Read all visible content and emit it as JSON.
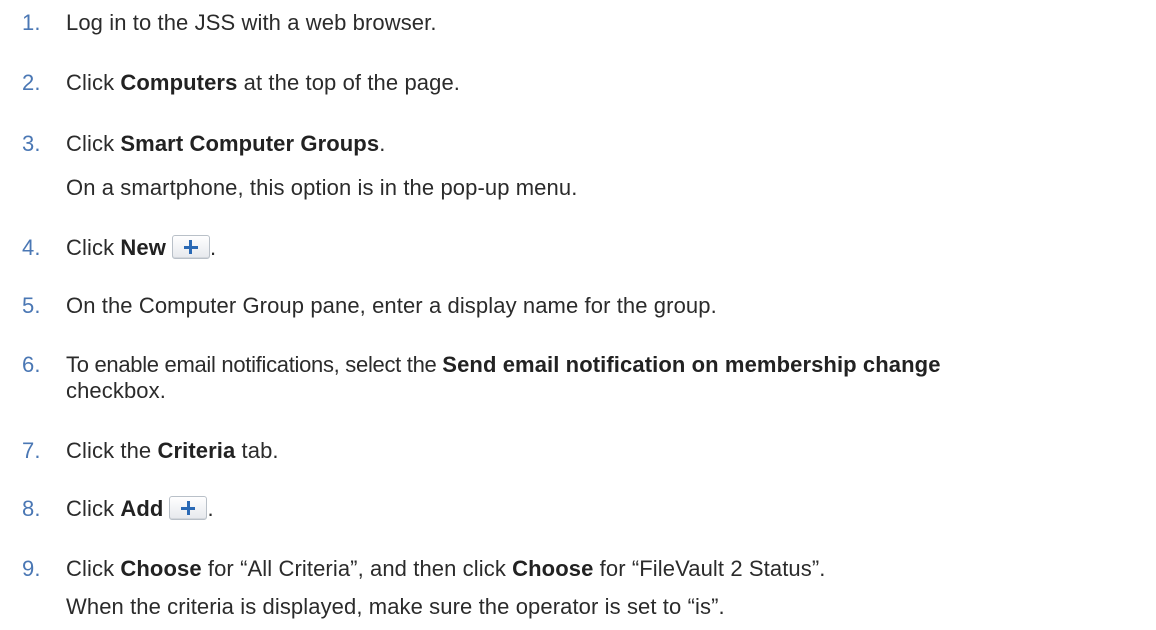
{
  "steps": [
    {
      "number": "1.",
      "parts": {
        "a": "Log in to the JSS with a web browser."
      }
    },
    {
      "number": "2.",
      "parts": {
        "a": "Click ",
        "b": "Computers",
        "c": " at the top of the page."
      }
    },
    {
      "number": "3.",
      "parts": {
        "a": "Click ",
        "b": "Smart Computer Groups",
        "c": "."
      },
      "note": "On a smartphone, this option is in the pop-up menu."
    },
    {
      "number": "4.",
      "parts": {
        "a": "Click ",
        "b": "New",
        "c": "."
      },
      "icon": "plus-icon"
    },
    {
      "number": "5.",
      "parts": {
        "a": "On the Computer Group pane, enter a display name for the group."
      }
    },
    {
      "number": "6.",
      "parts": {
        "a": "To enable email notifications, select the ",
        "b": "Send email notification on membership change"
      },
      "continuation": "checkbox."
    },
    {
      "number": "7.",
      "parts": {
        "a": "Click the ",
        "b": "Criteria",
        "c": " tab."
      }
    },
    {
      "number": "8.",
      "parts": {
        "a": "Click ",
        "b": "Add",
        "c": "."
      },
      "icon": "plus-icon"
    },
    {
      "number": "9.",
      "parts": {
        "a": "Click ",
        "b": "Choose",
        "c": " for “All Criteria”, and then click ",
        "d": "Choose",
        "e": " for “FileVault 2 Status”."
      },
      "note": "When the criteria is displayed, make sure the operator is set to “is”."
    }
  ]
}
